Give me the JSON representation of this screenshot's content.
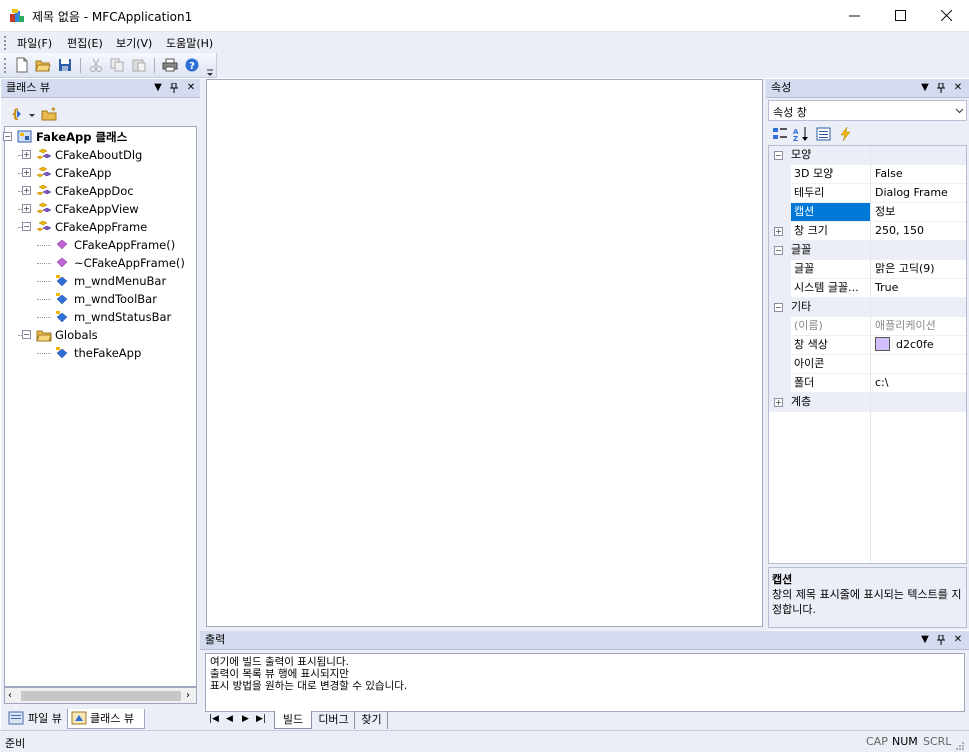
{
  "window": {
    "title": "제목 없음 - MFCApplication1",
    "controls": [
      "minimize",
      "maximize",
      "close"
    ]
  },
  "menu": [
    {
      "label": "파일(F)"
    },
    {
      "label": "편집(E)"
    },
    {
      "label": "보기(V)"
    },
    {
      "label": "도움말(H)"
    }
  ],
  "toolbar": {
    "icons": [
      "new-icon",
      "open-icon",
      "save-icon",
      "cut-icon",
      "copy-icon",
      "paste-icon",
      "print-icon",
      "help-icon"
    ]
  },
  "class_view": {
    "title": "클래스 뷰",
    "root": "FakeApp 클래스",
    "items": [
      {
        "label": "CFakeAboutDlg",
        "level": 1,
        "expander": "+",
        "icon": "class"
      },
      {
        "label": "CFakeApp",
        "level": 1,
        "expander": "+",
        "icon": "class"
      },
      {
        "label": "CFakeAppDoc",
        "level": 1,
        "expander": "+",
        "icon": "class"
      },
      {
        "label": "CFakeAppView",
        "level": 1,
        "expander": "+",
        "icon": "class"
      },
      {
        "label": "CFakeAppFrame",
        "level": 1,
        "expander": "-",
        "icon": "class"
      },
      {
        "label": "CFakeAppFrame()",
        "level": 2,
        "expander": "",
        "icon": "method"
      },
      {
        "label": "~CFakeAppFrame()",
        "level": 2,
        "expander": "",
        "icon": "method"
      },
      {
        "label": "m_wndMenuBar",
        "level": 2,
        "expander": "",
        "icon": "field"
      },
      {
        "label": "m_wndToolBar",
        "level": 2,
        "expander": "",
        "icon": "field"
      },
      {
        "label": "m_wndStatusBar",
        "level": 2,
        "expander": "",
        "icon": "field"
      },
      {
        "label": "Globals",
        "level": 1,
        "expander": "-",
        "icon": "folder"
      },
      {
        "label": "theFakeApp",
        "level": 2,
        "expander": "",
        "icon": "field"
      }
    ],
    "tabs": [
      {
        "label": "파일 뷰"
      },
      {
        "label": "클래스 뷰"
      }
    ]
  },
  "properties": {
    "title": "속성",
    "dropdown": "속성 창",
    "categories": [
      {
        "label": "모양",
        "expanded": true,
        "rows": [
          {
            "name": "3D 모양",
            "value": "False"
          },
          {
            "name": "테두리",
            "value": "Dialog Frame"
          },
          {
            "name": "캡션",
            "value": "정보",
            "selected": true
          },
          {
            "name": "창 크기",
            "value": "250, 150",
            "expander": "+"
          }
        ]
      },
      {
        "label": "글꼴",
        "expanded": true,
        "rows": [
          {
            "name": "글꼴",
            "value": "맑은 고딕(9)"
          },
          {
            "name": "시스템 글꼴...",
            "value": "True"
          }
        ]
      },
      {
        "label": "기타",
        "expanded": true,
        "rows": [
          {
            "name": "(이름)",
            "value": "애플리케이션",
            "disabled": true
          },
          {
            "name": "창 색상",
            "value": "d2c0fe",
            "swatch": "#d2c0fe"
          },
          {
            "name": "아이콘",
            "value": ""
          },
          {
            "name": "폴더",
            "value": "c:\\"
          }
        ]
      },
      {
        "label": "계층",
        "expanded": false,
        "rows": []
      }
    ],
    "description": {
      "title": "캡션",
      "text": "창의 제목 표시줄에 표시되는 텍스트를 지정합니다."
    }
  },
  "output": {
    "title": "출력",
    "lines": [
      "여기에 빌드 출력이 표시됩니다.",
      "출력이 목록 뷰 행에 표시되지만",
      "표시 방법을 원하는 대로 변경할 수 있습니다."
    ],
    "tabs": [
      "빌드",
      "디버그",
      "찾기"
    ]
  },
  "status": {
    "text": "준비",
    "indicators": [
      "CAP",
      "NUM",
      "SCRL"
    ]
  },
  "colors": {
    "chrome": "#eceef7",
    "header": "#d5dbef",
    "selection": "#0078d7"
  }
}
